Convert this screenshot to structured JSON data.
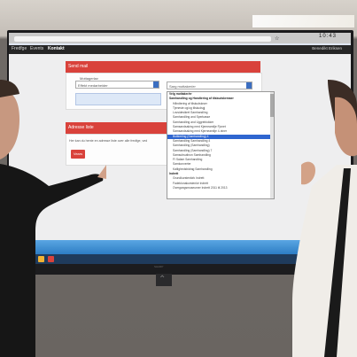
{
  "browser": {
    "clock": "10:43"
  },
  "nav": {
    "items": [
      "Fredfge",
      "Events",
      "Kontakt"
    ],
    "user": "Benedikt Eriksen"
  },
  "send_mail": {
    "header": "Send mail",
    "recipient_label": "Mottagerlav",
    "recipient_value": "Effekt medarbeider",
    "dropdown_value": "Sarg mottaker/er"
  },
  "address_section": {
    "header": "Adresse liste",
    "help_text": "Her kan du hente en adresse liste over alle fredfge, ved",
    "button_label": "Vears"
  },
  "dropdown_items": [
    {
      "label": "Velg mottaker/er",
      "type": "group"
    },
    {
      "label": "Samhandling og Handtering af tilskudskemaer",
      "type": "group"
    },
    {
      "label": "Håndtering af tilskudsloser",
      "type": "item"
    },
    {
      "label": "Tjeneste og/og tilskudsgj",
      "type": "item"
    },
    {
      "label": "Lovsidesikret Samhandling",
      "type": "item"
    },
    {
      "label": "Samhandling and Sperkasse",
      "type": "item"
    },
    {
      "label": "Samhandling and Uggreblokker",
      "type": "item"
    },
    {
      "label": "Samsandsaking med Kjemeamilje Fjonet",
      "type": "item"
    },
    {
      "label": "Samsandsaking med Kjerneamilje 4-niner",
      "type": "item"
    },
    {
      "label": "Butikerling (Samhandling) 4",
      "type": "selected"
    },
    {
      "label": "Samhandling Samhandling 4",
      "type": "item"
    },
    {
      "label": "Samhandling (Samhandling)",
      "type": "item"
    },
    {
      "label": "Samhandling (Samhandling) 7",
      "type": "item"
    },
    {
      "label": "Samsubsutinon Samhandling",
      "type": "item"
    },
    {
      "label": "FI Salam Samhandling",
      "type": "item"
    },
    {
      "label": "Samkonverter",
      "type": "item"
    },
    {
      "label": "Kallighedsbidrag Samhandling",
      "type": "item"
    },
    {
      "label": "Indrett",
      "type": "group"
    },
    {
      "label": "Grundkurstenkirk Indrett",
      "type": "item"
    },
    {
      "label": "Fadeklonakurstenkir Indrett",
      "type": "item"
    },
    {
      "label": "Overgangsmuseumer Indrett 2011 til 2013",
      "type": "item"
    }
  ],
  "tv": {
    "brand": "SHARP"
  },
  "colors": {
    "accent": "#d9423b",
    "selection": "#2f66d0",
    "navbar": "#262626"
  }
}
